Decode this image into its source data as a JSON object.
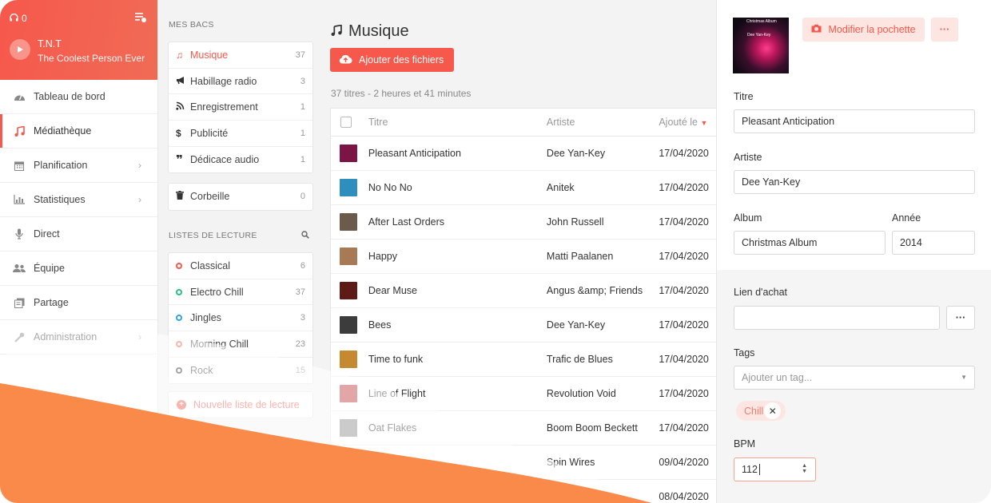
{
  "player": {
    "listeners": "0",
    "station": "T.N.T",
    "tagline": "The Coolest Person Ever"
  },
  "nav": {
    "items": [
      {
        "label": "Tableau de bord",
        "icon": "dashboard-icon"
      },
      {
        "label": "Médiathèque",
        "icon": "music-note-icon",
        "active": true
      },
      {
        "label": "Planification",
        "icon": "calendar-icon"
      },
      {
        "label": "Statistiques",
        "icon": "bar-chart-icon"
      },
      {
        "label": "Direct",
        "icon": "microphone-icon"
      },
      {
        "label": "Équipe",
        "icon": "users-icon"
      },
      {
        "label": "Partage",
        "icon": "share-icon"
      },
      {
        "label": "Administration",
        "icon": "wrench-icon"
      }
    ]
  },
  "bins": {
    "section_label": "MES BACS",
    "items": [
      {
        "label": "Musique",
        "count": "37",
        "icon": "music-note-icon"
      },
      {
        "label": "Habillage radio",
        "count": "3",
        "icon": "megaphone-icon"
      },
      {
        "label": "Enregistrement",
        "count": "1",
        "icon": "rss-icon"
      },
      {
        "label": "Publicité",
        "count": "1",
        "icon": "dollar-icon"
      },
      {
        "label": "Dédicace audio",
        "count": "1",
        "icon": "quote-icon"
      }
    ],
    "trash": {
      "label": "Corbeille",
      "count": "0"
    }
  },
  "playlists": {
    "section_label": "LISTES DE LECTURE",
    "items": [
      {
        "label": "Classical",
        "count": "6",
        "color": "#f6584b"
      },
      {
        "label": "Electro Chill",
        "count": "37",
        "color": "#27c281"
      },
      {
        "label": "Jingles",
        "count": "3",
        "color": "#2ea6d9"
      },
      {
        "label": "Morning Chill",
        "count": "23",
        "color": "#f6584b"
      },
      {
        "label": "Rock",
        "count": "15",
        "color": "#333333"
      }
    ],
    "new_label": "Nouvelle liste de lecture"
  },
  "main": {
    "title": "Musique",
    "add_button": "Ajouter des fichiers",
    "summary": "37 titres - 2 heures et 41 minutes",
    "columns": {
      "title": "Titre",
      "artist": "Artiste",
      "added": "Ajouté le"
    },
    "rows": [
      {
        "title": "Pleasant Anticipation",
        "artist": "Dee Yan-Key",
        "date": "17/04/2020",
        "thumb": "#7a1546"
      },
      {
        "title": "No No No",
        "artist": "Anitek",
        "date": "17/04/2020",
        "thumb": "#2e8fbf"
      },
      {
        "title": "After Last Orders",
        "artist": "John Russell",
        "date": "17/04/2020",
        "thumb": "#6c5a4a"
      },
      {
        "title": "Happy",
        "artist": "Matti Paalanen",
        "date": "17/04/2020",
        "thumb": "#a57a55"
      },
      {
        "title": "Dear Muse",
        "artist": "Angus &amp; Friends",
        "date": "17/04/2020",
        "thumb": "#5e1a14"
      },
      {
        "title": "Bees",
        "artist": "Dee Yan-Key",
        "date": "17/04/2020",
        "thumb": "#3c3c3c"
      },
      {
        "title": "Time to funk",
        "artist": "Trafic de Blues",
        "date": "17/04/2020",
        "thumb": "#c58a30"
      },
      {
        "title": "Line of Flight",
        "artist": "Revolution Void",
        "date": "17/04/2020",
        "thumb": "#c23a3a"
      },
      {
        "title": "Oat Flakes",
        "artist": "Boom Boom Beckett",
        "date": "17/04/2020",
        "thumb": "#8c8c8c"
      },
      {
        "title": "",
        "artist": "Spin Wires",
        "date": "09/04/2020",
        "thumb": "#555555"
      },
      {
        "title": "",
        "artist": "",
        "date": "08/04/2020",
        "thumb": "#777777"
      }
    ]
  },
  "panel": {
    "cover_title": "Christmas Album",
    "cover_artist": "Dee Yan-Key",
    "edit_cover": "Modifier la pochette",
    "more": "···",
    "title_label": "Titre",
    "title_value": "Pleasant Anticipation",
    "artist_label": "Artiste",
    "artist_value": "Dee Yan-Key",
    "album_label": "Album",
    "album_value": "Christmas Album",
    "year_label": "Année",
    "year_value": "2014",
    "buy_label": "Lien d'achat",
    "buy_value": "",
    "tags_label": "Tags",
    "tags_placeholder": "Ajouter un tag...",
    "tag": "Chill",
    "bpm_label": "BPM",
    "bpm_value": "112"
  },
  "colors": {
    "accent": "#f6584b",
    "wave": "#fa8a4a"
  }
}
